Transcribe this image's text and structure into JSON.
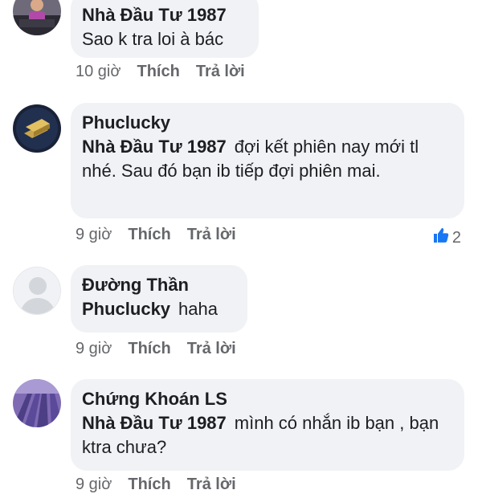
{
  "comments": [
    {
      "author": "Nhà Đầu Tư 1987",
      "mention": "",
      "text": "Sao k tra loi à bác",
      "time": "10 giờ",
      "like_label": "Thích",
      "reply_label": "Trả lời",
      "reaction_count": ""
    },
    {
      "author": "Phuclucky",
      "mention": "Nhà Đầu Tư 1987",
      "text": "đợi kết phiên nay mới tl nhé. Sau đó bạn ib tiếp đợi phiên mai.",
      "time": "9 giờ",
      "like_label": "Thích",
      "reply_label": "Trả lời",
      "reaction_count": "2"
    },
    {
      "author": "Đường Thần",
      "mention": "Phuclucky",
      "text": "haha",
      "time": "9 giờ",
      "like_label": "Thích",
      "reply_label": "Trả lời",
      "reaction_count": ""
    },
    {
      "author": "Chứng Khoán LS",
      "mention": "Nhà Đầu Tư 1987",
      "text": "mình có nhắn ib bạn , bạn ktra chưa?",
      "time": "9 giờ",
      "like_label": "Thích",
      "reply_label": "Trả lời",
      "reaction_count": ""
    }
  ],
  "colors": {
    "bubble": "#f0f2f5",
    "meta_text": "#65676b",
    "like_icon": "#1877f2"
  }
}
